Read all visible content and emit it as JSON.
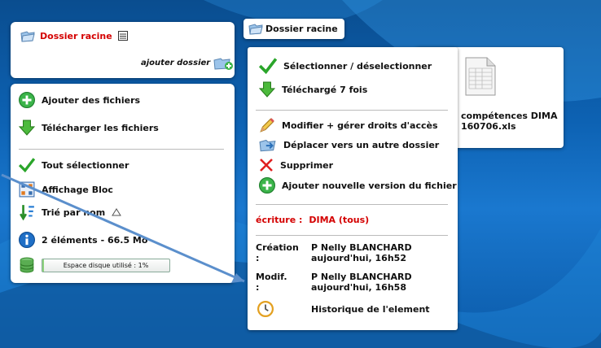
{
  "colors": {
    "accent_red": "#d40000",
    "bg_blue": "#0d62b3",
    "arrow": "#5b8fcc"
  },
  "root_box": {
    "title": "Dossier racine",
    "add_folder_label": "ajouter dossier"
  },
  "breadcrumb": {
    "label": "Dossier racine"
  },
  "left_panel": {
    "add_files": "Ajouter des fichiers",
    "download_files": "Télécharger les fichiers",
    "select_all": "Tout sélectionner",
    "display_block": "Affichage Bloc",
    "sort_by_name": "Trié par nom",
    "elements_info": "2 éléments - 66.5 Mo",
    "disk_usage": "Espace disque utilisé : 1%",
    "disk_usage_percent": 1
  },
  "file_card": {
    "filename_line1": "compétences DIMA",
    "filename_line2": "160706.xls"
  },
  "context_menu": {
    "select_toggle": "Sélectionner / déselectionner",
    "download_count": "Téléchargé 7 fois",
    "edit_rights": "Modifier + gérer droits d'accès",
    "move_to_folder": "Déplacer vers un autre dossier",
    "delete": "Supprimer",
    "add_new_version": "Ajouter nouvelle version du fichier",
    "write_label": "écriture :",
    "write_value": "DIMA (tous)",
    "creation_label": "Création :",
    "creation_user": "P Nelly BLANCHARD",
    "creation_date": "aujourd'hui, 16h52",
    "modif_label": "Modif. :",
    "modif_user": "P Nelly BLANCHARD",
    "modif_date": "aujourd'hui, 16h58",
    "history": "Historique de l'element"
  }
}
